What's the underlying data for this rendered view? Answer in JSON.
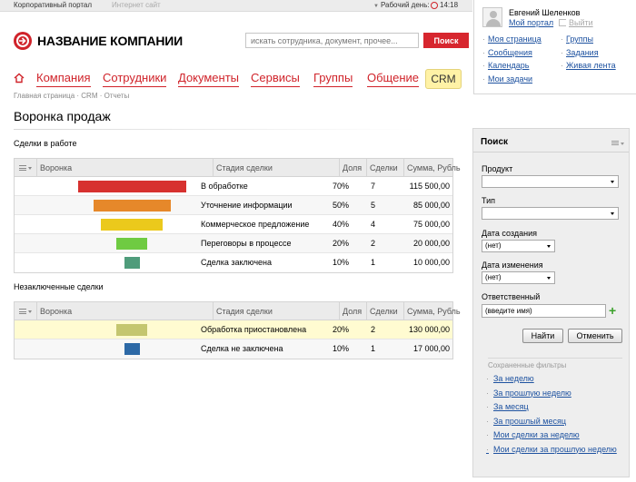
{
  "topbar": {
    "portal": "Корпоративный портал",
    "site": "Интернет сайт",
    "workday_label": "Рабочий день:",
    "time": "14:18"
  },
  "logo": {
    "text": "НАЗВАНИЕ КОМПАНИИ"
  },
  "search": {
    "placeholder": "искать сотрудника, документ, прочее...",
    "button": "Поиск"
  },
  "nav": {
    "items": [
      "Компания",
      "Сотрудники",
      "Документы",
      "Сервисы",
      "Группы",
      "Общение"
    ],
    "crm": "CRM"
  },
  "breadcrumb": [
    "Главная страница",
    "CRM",
    "Отчеты"
  ],
  "page": {
    "title": "Воронка продаж"
  },
  "columns": {
    "funnel": "Воронка",
    "stage": "Стадия сделки",
    "share": "Доля",
    "deals": "Сделки",
    "sum": "Сумма, Рубль"
  },
  "active": {
    "title": "Сделки в работе",
    "rows": [
      {
        "stage": "В обработке",
        "share": "70%",
        "deals": "7",
        "sum": "115 500,00",
        "color": "#d7312f",
        "fraction": 0.7
      },
      {
        "stage": "Уточнение информации",
        "share": "50%",
        "deals": "5",
        "sum": "85 000,00",
        "color": "#e6882a",
        "fraction": 0.5
      },
      {
        "stage": "Коммерческое предложение",
        "share": "40%",
        "deals": "4",
        "sum": "75 000,00",
        "color": "#ebc91c",
        "fraction": 0.4
      },
      {
        "stage": "Переговоры в процессе",
        "share": "20%",
        "deals": "2",
        "sum": "20 000,00",
        "color": "#6fcb42",
        "fraction": 0.2
      },
      {
        "stage": "Сделка заключена",
        "share": "10%",
        "deals": "1",
        "sum": "10 000,00",
        "color": "#4f9c7b",
        "fraction": 0.1
      }
    ]
  },
  "closed": {
    "title": "Незаключенные сделки",
    "rows": [
      {
        "stage": "Обработка приостановлена",
        "share": "20%",
        "deals": "2",
        "sum": "130 000,00",
        "color": "#c4c66f",
        "fraction": 0.2
      },
      {
        "stage": "Сделка не заключена",
        "share": "10%",
        "deals": "1",
        "sum": "17 000,00",
        "color": "#2d69a6",
        "fraction": 0.1
      }
    ]
  },
  "user": {
    "name": "Евгений Шеленков",
    "my_portal": "Мой портал",
    "logout": "Выйти",
    "links_left": [
      "Моя страница",
      "Сообщения",
      "Календарь",
      "Мои задачи"
    ],
    "links_right": [
      "Группы",
      "Задания",
      "Живая лента"
    ]
  },
  "filter": {
    "title": "Поиск",
    "product_label": "Продукт",
    "product_value": "",
    "type_label": "Тип",
    "type_value": "",
    "created_label": "Дата создания",
    "created_value": "(нет)",
    "changed_label": "Дата изменения",
    "changed_value": "(нет)",
    "responsible_label": "Ответственный",
    "responsible_placeholder": "(введите имя)",
    "find": "Найти",
    "cancel": "Отменить",
    "saved_title": "Сохраненные фильтры",
    "saved": [
      "За неделю",
      "За прошлую неделю",
      "За месяц",
      "За прошлый месяц",
      "Мои сделки за неделю",
      "Мои сделки за прошлую неделю"
    ]
  }
}
